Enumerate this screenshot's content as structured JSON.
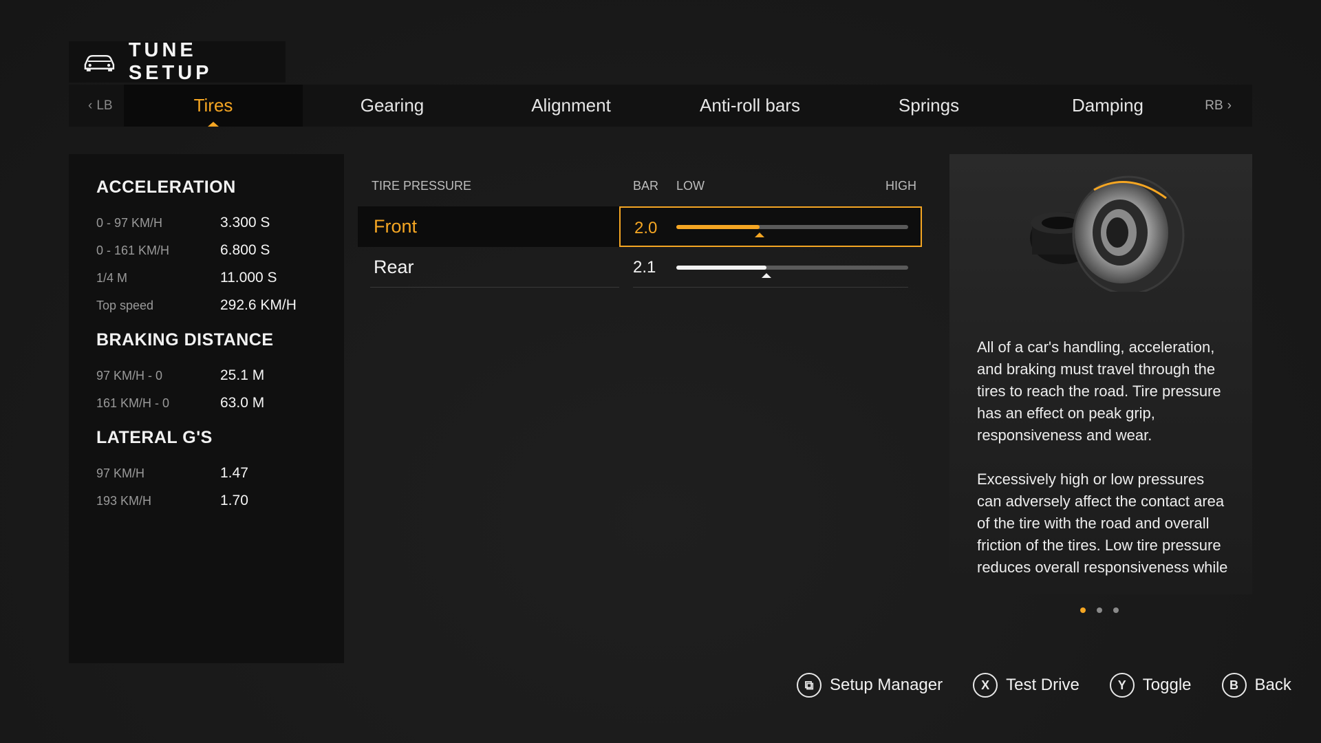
{
  "header": {
    "title": "TUNE SETUP",
    "icon": "car-icon"
  },
  "tabs": {
    "left_hint": "LB",
    "right_hint": "RB",
    "items": [
      {
        "label": "Tires",
        "active": true
      },
      {
        "label": "Gearing"
      },
      {
        "label": "Alignment"
      },
      {
        "label": "Anti-roll bars"
      },
      {
        "label": "Springs"
      },
      {
        "label": "Damping"
      }
    ]
  },
  "stats": {
    "acceleration": {
      "heading": "ACCELERATION",
      "rows": [
        {
          "label": "0 - 97 KM/H",
          "value": "3.300 S"
        },
        {
          "label": "0 - 161 KM/H",
          "value": "6.800 S"
        },
        {
          "label": "1/4 M",
          "value": "11.000 S"
        },
        {
          "label": "Top speed",
          "value": "292.6 KM/H"
        }
      ]
    },
    "braking": {
      "heading": "BRAKING DISTANCE",
      "rows": [
        {
          "label": "97 KM/H - 0",
          "value": "25.1 M"
        },
        {
          "label": "161 KM/H - 0",
          "value": "63.0 M"
        }
      ]
    },
    "lateral": {
      "heading": "LATERAL G'S",
      "rows": [
        {
          "label": "97 KM/H",
          "value": "1.47"
        },
        {
          "label": "193 KM/H",
          "value": "1.70"
        }
      ]
    }
  },
  "tuning": {
    "section_label": "TIRE PRESSURE",
    "unit": "BAR",
    "low_label": "LOW",
    "high_label": "HIGH",
    "rows": [
      {
        "name": "Front",
        "value": "2.0",
        "fill_fraction": 0.36,
        "selected": true
      },
      {
        "name": "Rear",
        "value": "2.1",
        "fill_fraction": 0.39,
        "selected": false
      }
    ]
  },
  "info": {
    "image": "tire-illustration",
    "paragraphs": [
      "All of a car's handling, acceleration, and braking must travel through the tires to reach the road. Tire pressure has an effect on peak grip, responsiveness and wear.",
      "Excessively high or low pressures can adversely affect the contact area of the tire with the road and overall friction of the tires. Low tire pressure reduces overall responsiveness while high tire"
    ],
    "pages": 3,
    "current_page": 1
  },
  "footer": {
    "hints": [
      {
        "button": "⧉",
        "label": "Setup Manager",
        "icon": "setup-manager-icon"
      },
      {
        "button": "X",
        "label": "Test Drive",
        "icon": "x-button-icon"
      },
      {
        "button": "Y",
        "label": "Toggle",
        "icon": "y-button-icon"
      },
      {
        "button": "B",
        "label": "Back",
        "icon": "b-button-icon"
      }
    ]
  },
  "colors": {
    "accent": "#f5a623",
    "panel": "#101010",
    "background": "#1b1b1b"
  }
}
